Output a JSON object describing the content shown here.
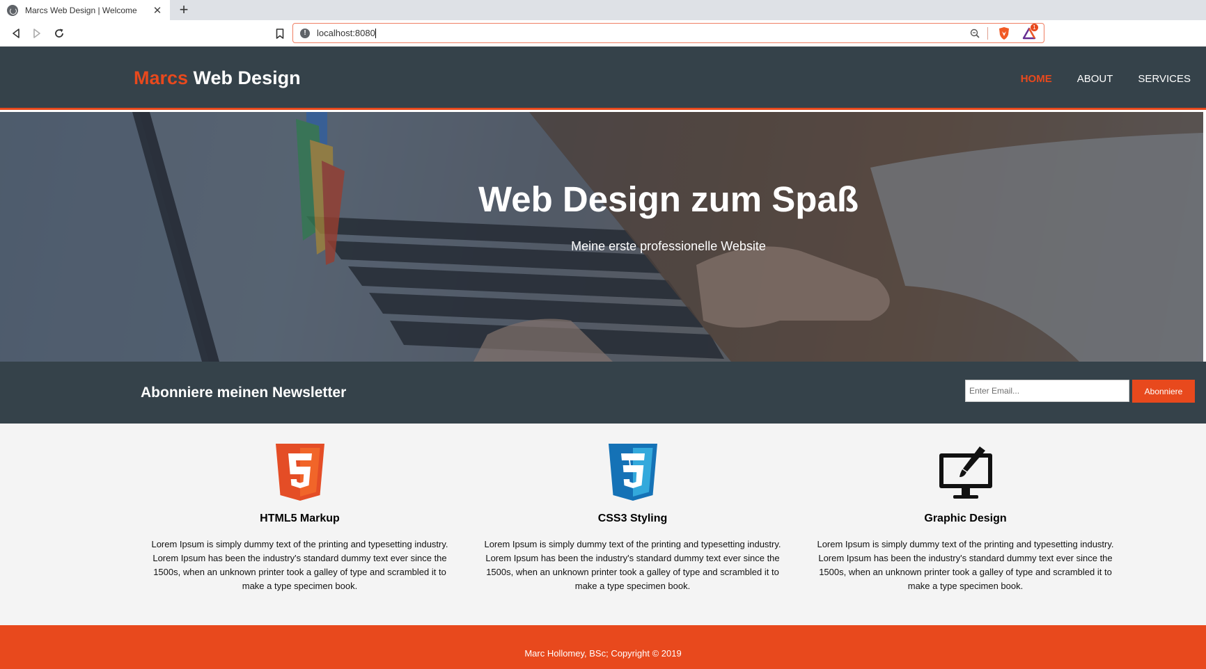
{
  "browser": {
    "tab_title": "Marcs Web Design | Welcome",
    "tab_close": "✕",
    "new_tab": "+",
    "url": "localhost:8080",
    "icons": [
      "back-icon",
      "forward-icon",
      "reload-icon",
      "bookmark-icon",
      "info-icon",
      "zoom-icon",
      "brave-shield-icon",
      "brave-rewards-icon"
    ],
    "rewards_badge": "1"
  },
  "header": {
    "logo_highlight": "Marcs",
    "logo_rest": " Web Design",
    "nav": [
      {
        "label": "Home",
        "current": true
      },
      {
        "label": "About",
        "current": false
      },
      {
        "label": "Services",
        "current": false
      }
    ]
  },
  "showcase": {
    "title": "Web Design zum Spaß",
    "subtitle": "Meine erste professionelle Website"
  },
  "newsletter": {
    "heading": "Abonniere meinen Newsletter",
    "email_placeholder": "Enter Email...",
    "email_value": "",
    "button_label": "Abonniere"
  },
  "boxes": [
    {
      "icon": "html5-logo-icon",
      "title": "HTML5 Markup",
      "text": "Lorem Ipsum is simply dummy text of the printing and typesetting industry. Lorem Ipsum has been the industry's standard dummy text ever since the 1500s, when an unknown printer took a galley of type and scrambled it to make a type specimen book."
    },
    {
      "icon": "css3-logo-icon",
      "title": "CSS3 Styling",
      "text": "Lorem Ipsum is simply dummy text of the printing and typesetting industry. Lorem Ipsum has been the industry's standard dummy text ever since the 1500s, when an unknown printer took a galley of type and scrambled it to make a type specimen book."
    },
    {
      "icon": "graphic-design-monitor-icon",
      "title": "Graphic Design",
      "text": "Lorem Ipsum is simply dummy text of the printing and typesetting industry. Lorem Ipsum has been the industry's standard dummy text ever since the 1500s, when an unknown printer took a galley of type and scrambled it to make a type specimen book."
    }
  ],
  "footer": {
    "text": "Marc Hollomey, BSc; Copyright © 2019"
  },
  "colors": {
    "accent": "#e8491d",
    "dark": "#35424a",
    "light_bg": "#f4f4f4"
  }
}
